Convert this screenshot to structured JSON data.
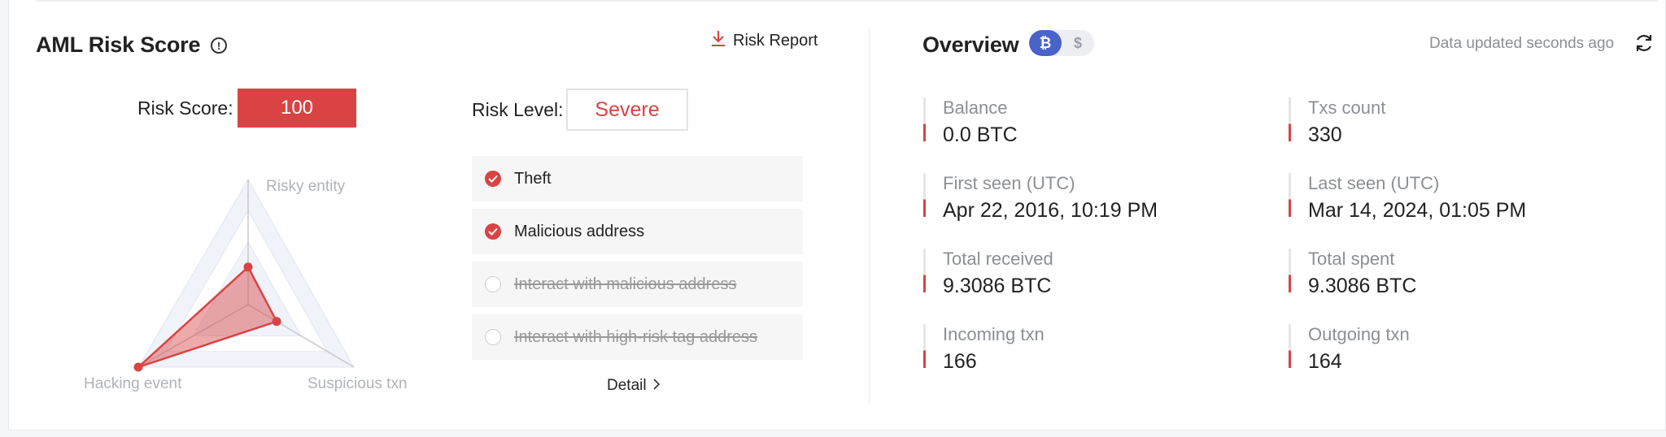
{
  "left": {
    "title": "AML Risk Score",
    "report_label": "Risk Report",
    "score_label": "Risk Score:",
    "score_value": "100",
    "level_label": "Risk Level:",
    "level_value": "Severe",
    "radar": {
      "axes": [
        "Risky entity",
        "Hacking event",
        "Suspicious txn"
      ],
      "values": [
        0.3,
        1.0,
        0.27
      ]
    },
    "risk_items": [
      {
        "label": "Theft",
        "checked": true
      },
      {
        "label": "Malicious address",
        "checked": true
      },
      {
        "label": "Interact with malicious address",
        "checked": false
      },
      {
        "label": "Interact with high-risk tag address",
        "checked": false
      }
    ],
    "detail_label": "Detail"
  },
  "right": {
    "title": "Overview",
    "coins": {
      "btc": "₿",
      "usd": "$"
    },
    "updated_text": "Data updated seconds ago",
    "stats": [
      {
        "label": "Balance",
        "value": "0.0 BTC"
      },
      {
        "label": "Txs count",
        "value": "330"
      },
      {
        "label": "First seen (UTC)",
        "value": "Apr 22, 2016, 10:19 PM"
      },
      {
        "label": "Last seen (UTC)",
        "value": "Mar 14, 2024, 01:05 PM"
      },
      {
        "label": "Total received",
        "value": "9.3086 BTC"
      },
      {
        "label": "Total spent",
        "value": "9.3086 BTC"
      },
      {
        "label": "Incoming txn",
        "value": "166"
      },
      {
        "label": "Outgoing txn",
        "value": "164"
      }
    ]
  },
  "colors": {
    "accent": "#d94343",
    "coin_active": "#4a63c8"
  }
}
